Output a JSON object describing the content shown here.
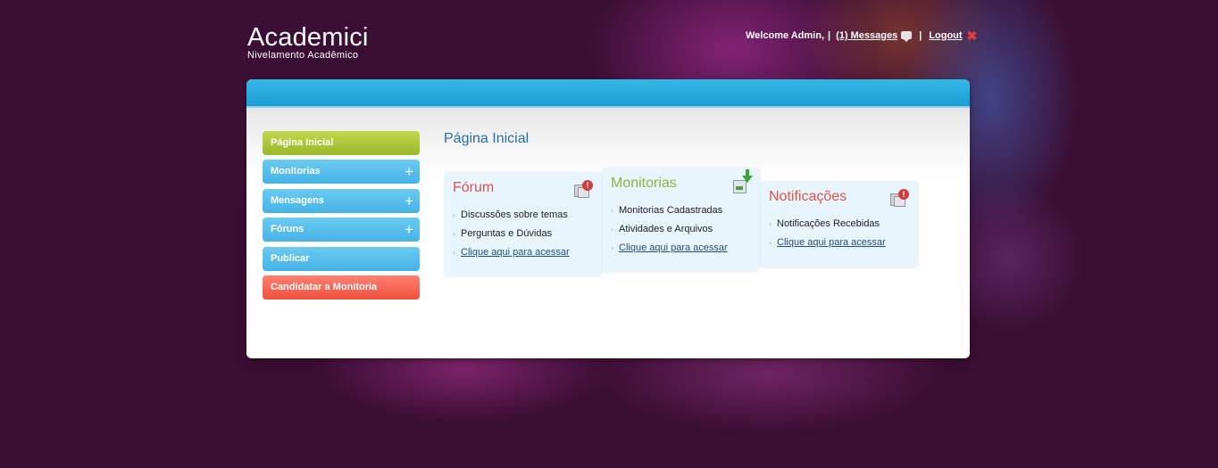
{
  "header": {
    "logo_title": "Academici",
    "logo_subtitle": "Nivelamento Acadêmico",
    "welcome": "Welcome Admin,",
    "separator": "|",
    "messages_link": "(1) Messages",
    "logout_link": "Logout"
  },
  "sidebar": {
    "items": [
      {
        "label": "Página Inicial",
        "color": "#a9c33a",
        "expandable": false
      },
      {
        "label": "Monitorias",
        "color": "#55bcea",
        "expandable": true
      },
      {
        "label": "Mensagens",
        "color": "#55bcea",
        "expandable": true
      },
      {
        "label": "Fóruns",
        "color": "#55bcea",
        "expandable": true
      },
      {
        "label": "Publicar",
        "color": "#55bcea",
        "expandable": false
      },
      {
        "label": "Candidatar a Monitoria",
        "color": "#f5614f",
        "expandable": false
      }
    ],
    "expand_symbol": "+"
  },
  "main": {
    "title": "Página Inicial",
    "cards": [
      {
        "title": "Fórum",
        "icon": "documents-alert-icon",
        "items": [
          "Discussões sobre temas",
          "Perguntas e Dúvidas"
        ],
        "link": "Clique aqui para acessar"
      },
      {
        "title": "Monitorias",
        "icon": "download-icon",
        "items": [
          "Monitorias Cadastradas",
          "Atividades e Arquivos"
        ],
        "link": "Clique aqui para acessar"
      },
      {
        "title": "Notificações",
        "icon": "documents-alert-icon",
        "items": [
          "Notificações Recebidas"
        ],
        "link": "Clique aqui para acessar"
      }
    ],
    "bullet": "›",
    "alert_symbol": "!"
  }
}
